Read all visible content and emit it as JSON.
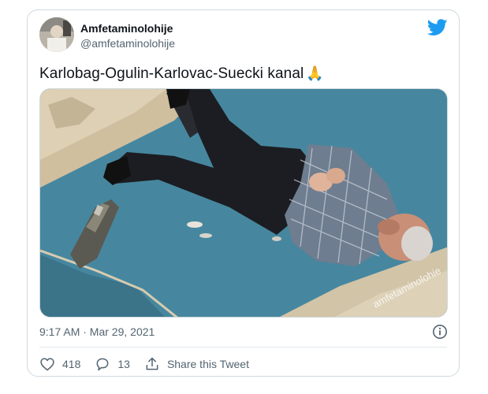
{
  "tweet": {
    "display_name": "Amfetaminolohije",
    "handle": "@amfetaminolohije",
    "text": "Karlobag-Ogulin-Karlovac-Suecki kanal",
    "emoji": "🙏",
    "timestamp": "9:17 AM · Mar 29, 2021",
    "likes": "418",
    "replies": "13",
    "share_label": "Share this Tweet"
  },
  "media": {
    "watermark": "amfetaminolohie"
  },
  "icons": {
    "brand": "twitter-bird-icon",
    "info": "info-icon",
    "like": "heart-icon",
    "reply": "reply-icon",
    "share": "share-icon"
  },
  "colors": {
    "brand_blue": "#1d9bf0",
    "text_primary": "#0f1419",
    "text_secondary": "#536471",
    "border": "#cfd9de"
  }
}
